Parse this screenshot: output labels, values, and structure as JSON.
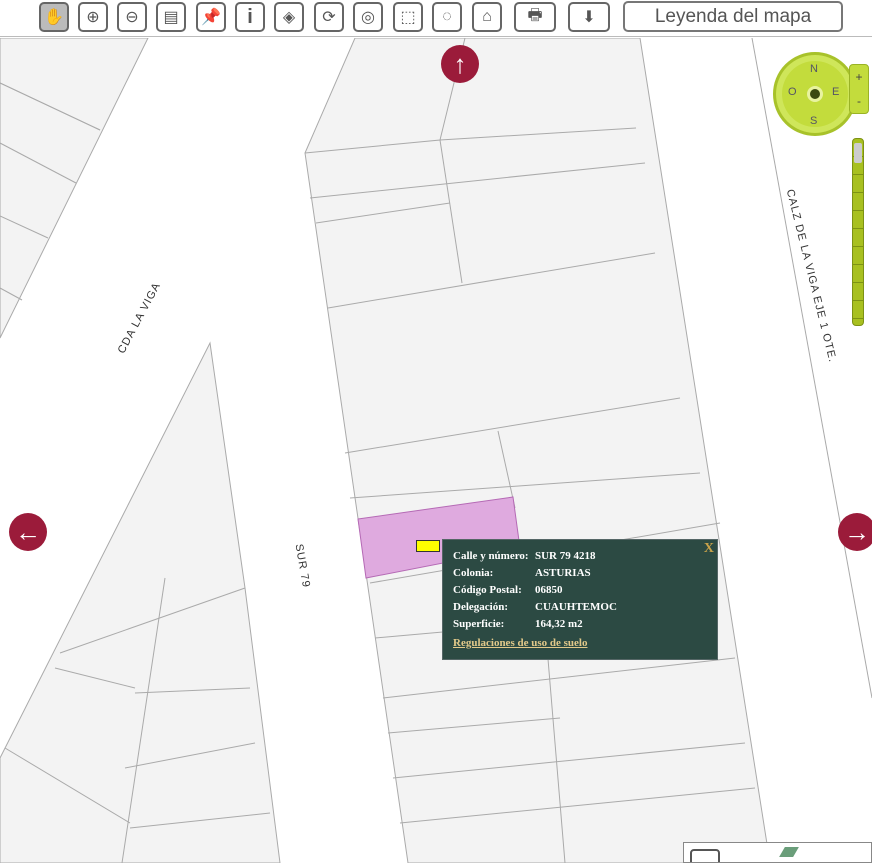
{
  "toolbar": {
    "tools": [
      "pan-hand",
      "zoom-in",
      "zoom-out",
      "measure",
      "pin",
      "info",
      "layers",
      "refresh",
      "buffer",
      "select-rectangle",
      "select-circle",
      "select-polygon",
      "print",
      "download"
    ],
    "legend_label": "Leyenda del mapa"
  },
  "map": {
    "streets": {
      "cda_la_viga": "CDA LA VIGA",
      "sur_79": "SUR 79",
      "calz_viga": "CALZ DE LA VIGA EJE 1 OTE."
    },
    "compass": {
      "n": "N",
      "s": "S",
      "e": "E",
      "o": "O",
      "plus": "+",
      "minus": "-"
    },
    "zoom_level_fraction": 0.9,
    "selected_color": "#dfaadf"
  },
  "popup": {
    "close": "X",
    "rows": [
      {
        "k": "Calle y número:",
        "v": "SUR 79 4218"
      },
      {
        "k": "Colonia:",
        "v": "ASTURIAS"
      },
      {
        "k": "Código Postal:",
        "v": "06850"
      },
      {
        "k": "Delegación:",
        "v": "CUAUHTEMOC"
      },
      {
        "k": "Superficie:",
        "v": "164,32 m2"
      }
    ],
    "link": "Regulaciones de uso de suelo"
  }
}
